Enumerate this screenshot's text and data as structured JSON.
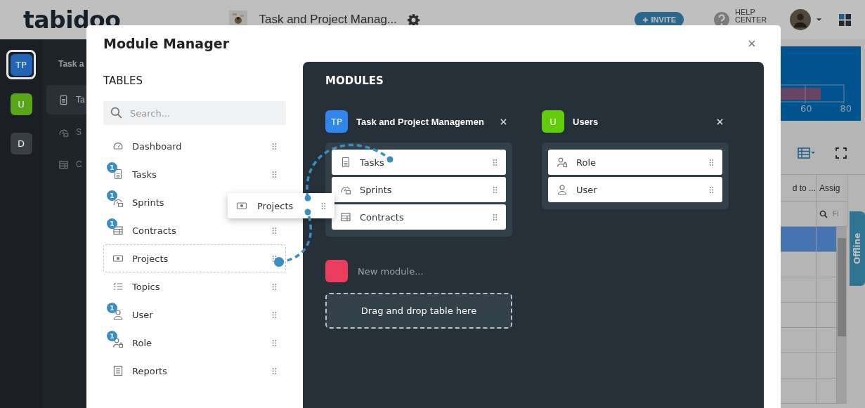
{
  "header": {
    "logo": "tabidoo",
    "app_title": "Task and Project Manag...",
    "invite": "INVITE",
    "help": "HELP CENTER"
  },
  "rail": [
    {
      "label": "TP",
      "color": "#2264b8",
      "selected": true
    },
    {
      "label": "U",
      "color": "#58a618",
      "selected": false
    },
    {
      "label": "D",
      "color": "#3a3f45",
      "selected": false
    }
  ],
  "sidebar": {
    "title": "Task a",
    "items": [
      {
        "label": "Ta",
        "kind": "document",
        "selected": true
      },
      {
        "label": "S",
        "kind": "gauge",
        "selected": false
      },
      {
        "label": "C",
        "kind": "table",
        "selected": false
      }
    ]
  },
  "background": {
    "chart_ticks": [
      "60",
      "80"
    ],
    "columns": [
      "d to ...",
      "Assig"
    ],
    "filter_placeholder": "Fi",
    "rows": [
      {
        "selected": true
      },
      {
        "selected": false
      },
      {
        "selected": false
      },
      {
        "selected": false
      },
      {
        "selected": false
      },
      {
        "selected": false
      },
      {
        "selected": false
      }
    ],
    "offline": "Offline"
  },
  "modal": {
    "title": "Module Manager",
    "tables_heading": "TABLES",
    "search_placeholder": "Search...",
    "tables": [
      {
        "label": "Dashboard",
        "kind": "dashboard",
        "dragging": false
      },
      {
        "label": "Tasks",
        "kind": "document",
        "badge": "1",
        "dragging": false
      },
      {
        "label": "Sprints",
        "kind": "gauge",
        "badge": "1",
        "dragging": false
      },
      {
        "label": "Contracts",
        "kind": "table",
        "badge": "1",
        "dragging": false
      },
      {
        "label": "Projects",
        "kind": "money",
        "dragging": true
      },
      {
        "label": "Topics",
        "kind": "list",
        "dragging": false
      },
      {
        "label": "User",
        "kind": "user",
        "badge": "1",
        "dragging": false
      },
      {
        "label": "Role",
        "kind": "role",
        "badge": "1",
        "dragging": false
      },
      {
        "label": "Reports",
        "kind": "report",
        "dragging": false
      }
    ],
    "drag_ghost": {
      "label": "Projects",
      "kind": "money"
    },
    "modules_heading": "MODULES",
    "modules": [
      {
        "initials": "TP",
        "name": "Task and Project Managemen",
        "color": "#2f86eb",
        "tables": [
          {
            "label": "Tasks",
            "kind": "document"
          },
          {
            "label": "Sprints",
            "kind": "gauge"
          },
          {
            "label": "Contracts",
            "kind": "table"
          }
        ]
      },
      {
        "initials": "U",
        "name": "Users",
        "color": "#62cc0a",
        "tables": [
          {
            "label": "Role",
            "kind": "role"
          },
          {
            "label": "User",
            "kind": "user"
          }
        ]
      }
    ],
    "new_module": {
      "color": "#ea3d5d",
      "placeholder": "New module...",
      "drop_hint": "Drag and drop table here"
    }
  }
}
